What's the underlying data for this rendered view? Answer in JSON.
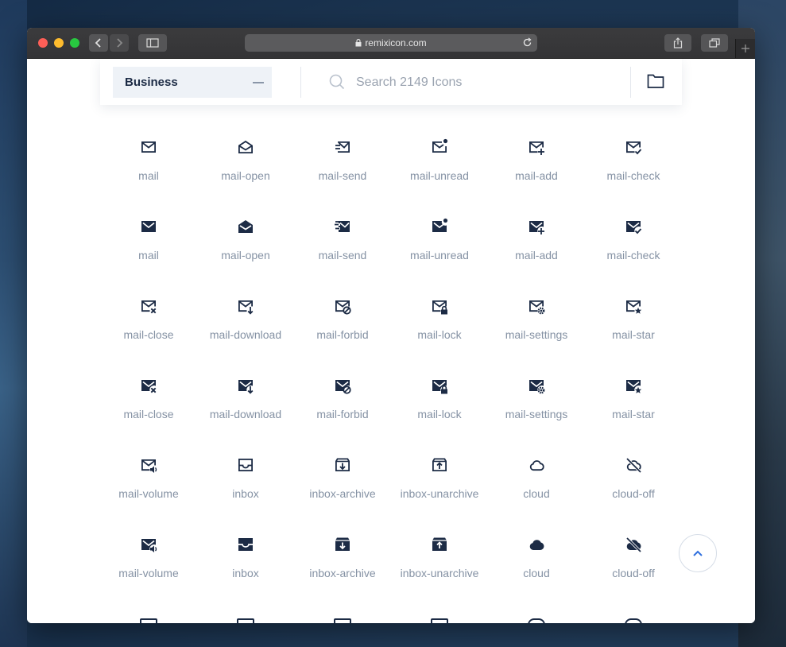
{
  "browser": {
    "url": "remixicon.com"
  },
  "search": {
    "category": "Business",
    "placeholder": "Search 2149 Icons"
  },
  "icons": [
    {
      "label": "mail",
      "style": "line",
      "glyph": "mail"
    },
    {
      "label": "mail-open",
      "style": "line",
      "glyph": "mail-open"
    },
    {
      "label": "mail-send",
      "style": "line",
      "glyph": "mail-send"
    },
    {
      "label": "mail-unread",
      "style": "line",
      "glyph": "mail-unread"
    },
    {
      "label": "mail-add",
      "style": "line",
      "glyph": "mail-add"
    },
    {
      "label": "mail-check",
      "style": "line",
      "glyph": "mail-check"
    },
    {
      "label": "mail",
      "style": "fill",
      "glyph": "mail"
    },
    {
      "label": "mail-open",
      "style": "fill",
      "glyph": "mail-open"
    },
    {
      "label": "mail-send",
      "style": "fill",
      "glyph": "mail-send"
    },
    {
      "label": "mail-unread",
      "style": "fill",
      "glyph": "mail-unread"
    },
    {
      "label": "mail-add",
      "style": "fill",
      "glyph": "mail-add"
    },
    {
      "label": "mail-check",
      "style": "fill",
      "glyph": "mail-check"
    },
    {
      "label": "mail-close",
      "style": "line",
      "glyph": "mail-close"
    },
    {
      "label": "mail-download",
      "style": "line",
      "glyph": "mail-download"
    },
    {
      "label": "mail-forbid",
      "style": "line",
      "glyph": "mail-forbid"
    },
    {
      "label": "mail-lock",
      "style": "line",
      "glyph": "mail-lock"
    },
    {
      "label": "mail-settings",
      "style": "line",
      "glyph": "mail-settings"
    },
    {
      "label": "mail-star",
      "style": "line",
      "glyph": "mail-star"
    },
    {
      "label": "mail-close",
      "style": "fill",
      "glyph": "mail-close"
    },
    {
      "label": "mail-download",
      "style": "fill",
      "glyph": "mail-download"
    },
    {
      "label": "mail-forbid",
      "style": "fill",
      "glyph": "mail-forbid"
    },
    {
      "label": "mail-lock",
      "style": "fill",
      "glyph": "mail-lock"
    },
    {
      "label": "mail-settings",
      "style": "fill",
      "glyph": "mail-settings"
    },
    {
      "label": "mail-star",
      "style": "fill",
      "glyph": "mail-star"
    },
    {
      "label": "mail-volume",
      "style": "line",
      "glyph": "mail-volume"
    },
    {
      "label": "inbox",
      "style": "line",
      "glyph": "inbox"
    },
    {
      "label": "inbox-archive",
      "style": "line",
      "glyph": "inbox-archive"
    },
    {
      "label": "inbox-unarchive",
      "style": "line",
      "glyph": "inbox-unarchive"
    },
    {
      "label": "cloud",
      "style": "line",
      "glyph": "cloud"
    },
    {
      "label": "cloud-off",
      "style": "line",
      "glyph": "cloud-off"
    },
    {
      "label": "mail-volume",
      "style": "fill",
      "glyph": "mail-volume"
    },
    {
      "label": "inbox",
      "style": "fill",
      "glyph": "inbox"
    },
    {
      "label": "inbox-archive",
      "style": "fill",
      "glyph": "inbox-archive"
    },
    {
      "label": "inbox-unarchive",
      "style": "fill",
      "glyph": "inbox-unarchive"
    },
    {
      "label": "cloud",
      "style": "fill",
      "glyph": "cloud"
    },
    {
      "label": "cloud-off",
      "style": "fill",
      "glyph": "cloud-off"
    }
  ],
  "colors": {
    "icon": "#1c2b45",
    "label": "#8592a4",
    "accent": "#2f6fde"
  }
}
